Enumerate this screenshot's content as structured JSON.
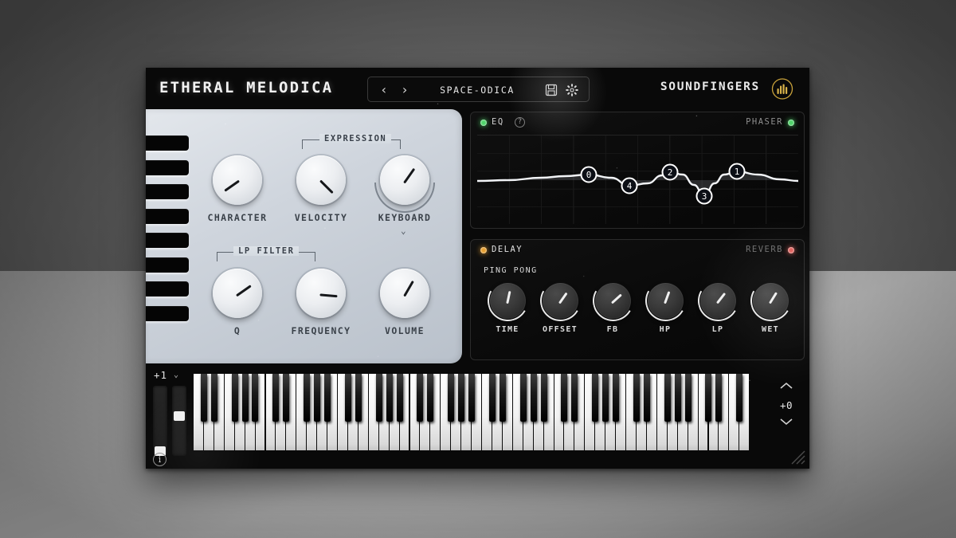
{
  "header": {
    "title": "ETHERAL MELODICA",
    "brand": "SOUNDFINGERS",
    "brand_color": "#c9a23a",
    "preset": {
      "name": "SPACE-ODICA",
      "prev_label": "‹",
      "next_label": "›",
      "save_icon": "floppy-disk-icon",
      "settings_icon": "gear-icon"
    }
  },
  "left_panel": {
    "expression": {
      "group_label": "EXPRESSION",
      "knobs": [
        {
          "label": "VELOCITY",
          "angle": 135
        },
        {
          "label": "KEYBOARD",
          "angle": 35
        }
      ]
    },
    "lp_filter": {
      "group_label": "LP FILTER",
      "knobs": [
        {
          "label": "Q",
          "angle": 55
        },
        {
          "label": "FREQUENCY",
          "angle": 95
        }
      ]
    },
    "character": {
      "label": "CHARACTER",
      "angle": 235
    },
    "volume": {
      "label": "VOLUME",
      "angle": 30
    },
    "melodica_key_count": 8
  },
  "eq_panel": {
    "tab_left": "EQ",
    "tab_right": "PHASER",
    "left_led_color": "#4fd46a",
    "right_led_color": "#4fd46a",
    "help_icon": "question-mark-icon",
    "chart_data": {
      "type": "line",
      "title": "EQ",
      "xlabel": "",
      "ylabel": "",
      "grid": true,
      "legend": "none",
      "xlim": [
        0,
        403
      ],
      "ylim": [
        0,
        112
      ],
      "bands": [
        {
          "id": "0",
          "x": 140,
          "y": 49
        },
        {
          "id": "4",
          "x": 191,
          "y": 63
        },
        {
          "id": "2",
          "x": 242,
          "y": 46
        },
        {
          "id": "3",
          "x": 285,
          "y": 76
        },
        {
          "id": "1",
          "x": 326,
          "y": 45
        }
      ],
      "baseline_y": 56,
      "curve_points": [
        [
          0,
          57
        ],
        [
          40,
          56
        ],
        [
          80,
          53
        ],
        [
          110,
          51
        ],
        [
          140,
          49
        ],
        [
          168,
          53
        ],
        [
          191,
          63
        ],
        [
          214,
          60
        ],
        [
          232,
          50
        ],
        [
          242,
          46
        ],
        [
          258,
          49
        ],
        [
          272,
          62
        ],
        [
          285,
          76
        ],
        [
          298,
          60
        ],
        [
          310,
          49
        ],
        [
          326,
          45
        ],
        [
          352,
          49
        ],
        [
          380,
          55
        ],
        [
          403,
          57
        ]
      ]
    }
  },
  "fx_panel": {
    "tab_left": "DELAY",
    "tab_right": "REVERB",
    "left_led_color": "#e6a032",
    "right_led_color": "#e0605c",
    "mode_label": "PING PONG",
    "knobs": [
      {
        "label": "TIME",
        "angle": 12
      },
      {
        "label": "OFFSET",
        "angle": 35
      },
      {
        "label": "FB",
        "angle": 48
      },
      {
        "label": "HP",
        "angle": 20
      },
      {
        "label": "LP",
        "angle": 38
      },
      {
        "label": "WET",
        "angle": 32
      }
    ]
  },
  "keyboard": {
    "transpose_label": "+1",
    "transpose_chevron": "⌄",
    "octave_value": "+0",
    "octave_up_icon": "chevron-up-icon",
    "octave_down_icon": "chevron-down-icon",
    "pitch_slider_pos": 86,
    "mod_slider_pos": 36,
    "white_key_count": 54,
    "info_icon": "info-icon",
    "resize_icon": "resize-grip-icon"
  }
}
